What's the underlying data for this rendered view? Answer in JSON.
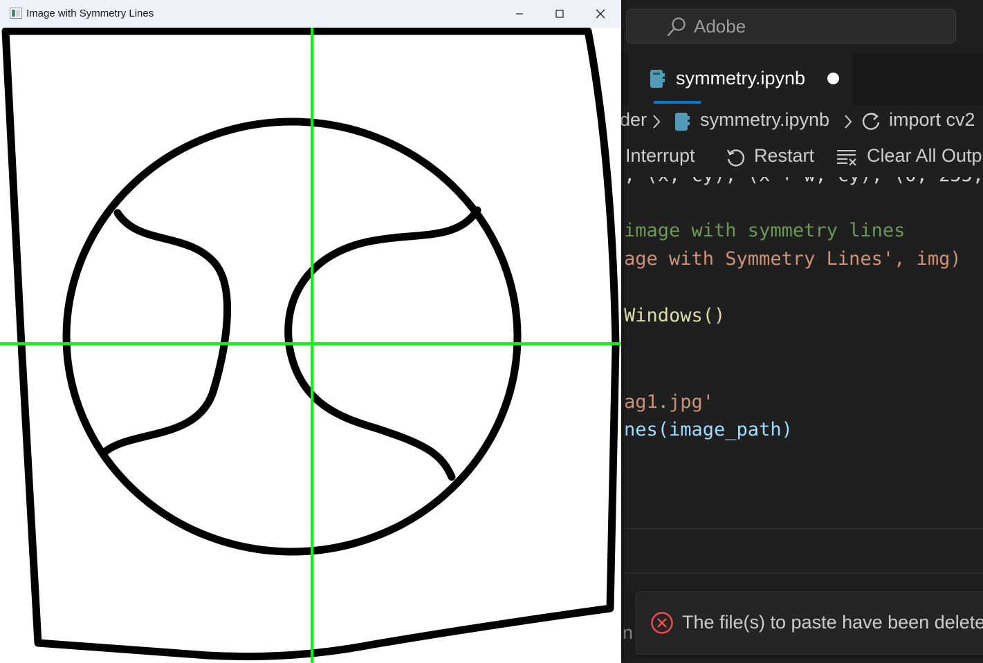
{
  "opencv_window": {
    "title": "Image with Symmetry Lines",
    "controls": [
      "minimize",
      "maximize",
      "close"
    ],
    "symmetry_line_color": "#00ff00",
    "drawing_stroke_color": "#000000"
  },
  "editor": {
    "search": {
      "text": "Adobe"
    },
    "active_tab": {
      "label": "symmetry.ipynb",
      "unsaved": true
    },
    "breadcrumb": [
      "der",
      "symmetry.ipynb",
      "import cv2"
    ],
    "toolbar": {
      "interrupt": "Interrupt",
      "restart": "Restart",
      "clear_all": "Clear All Outp"
    },
    "code_lines": [
      ", (x, cy), (x + w, cy), (0, 255,",
      "image with symmetry lines",
      "age with Symmetry Lines', img)",
      "Windows()",
      "ag1.jpg'",
      "nes(image_path)"
    ],
    "status_fragment": "n",
    "notification": {
      "text": "The file(s) to paste have been delete"
    },
    "accent_color": "#0078d4"
  }
}
